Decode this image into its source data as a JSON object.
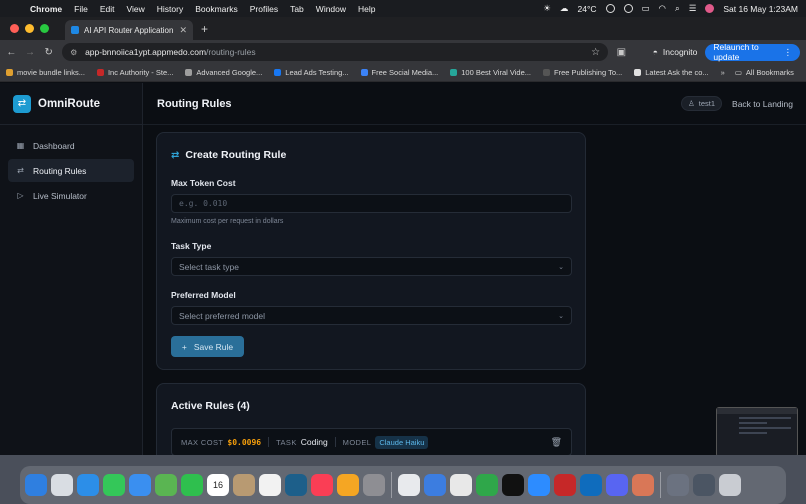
{
  "menubar": {
    "app": "Chrome",
    "items": [
      "File",
      "Edit",
      "View",
      "History",
      "Bookmarks",
      "Profiles",
      "Tab",
      "Window",
      "Help"
    ],
    "temperature": "24°C",
    "datetime": "Sat 16 May  1:23AM"
  },
  "browser": {
    "tab_title": "AI API Router Application",
    "url_host": "app-bnnoiica1ypt.appmedo.com",
    "url_path": "/routing-rules",
    "incognito_label": "Incognito",
    "relaunch_label": "Relaunch to update",
    "bookmarks": [
      {
        "label": "movie bundle links...",
        "color": "#e0a030"
      },
      {
        "label": "Inc Authority - Ste...",
        "color": "#c62828"
      },
      {
        "label": "Advanced Google...",
        "color": "#9e9e9e"
      },
      {
        "label": "Lead Ads Testing...",
        "color": "#1877f2"
      },
      {
        "label": "Free Social Media...",
        "color": "#3b82f6"
      },
      {
        "label": "100 Best Viral Vide...",
        "color": "#26a69a"
      },
      {
        "label": "Free Publishing To...",
        "color": "#555555"
      },
      {
        "label": "Latest Ask the co...",
        "color": "#e0e0e0"
      }
    ],
    "all_bookmarks_label": "All Bookmarks"
  },
  "app": {
    "brand": "OmniRoute",
    "nav": [
      {
        "label": "Dashboard",
        "icon": "dashboard-icon",
        "active": false
      },
      {
        "label": "Routing Rules",
        "icon": "routing-icon",
        "active": true
      },
      {
        "label": "Live Simulator",
        "icon": "play-icon",
        "active": false
      }
    ],
    "page_title": "Routing Rules",
    "user": "test1",
    "back_link": "Back to Landing",
    "create_form": {
      "title": "Create Routing Rule",
      "max_token_cost_label": "Max Token Cost",
      "max_token_cost_placeholder": "e.g. 0.010",
      "max_token_cost_hint": "Maximum cost per request in dollars",
      "task_type_label": "Task Type",
      "task_type_placeholder": "Select task type",
      "preferred_model_label": "Preferred Model",
      "preferred_model_placeholder": "Select preferred model",
      "save_label": "Save Rule"
    },
    "active_rules": {
      "title": "Active Rules (4)",
      "rules": [
        {
          "max_cost_label": "MAX COST",
          "max_cost": "$0.0096",
          "task_label": "TASK",
          "task": "Coding",
          "model_label": "MODEL",
          "model": "Claude Haiku"
        }
      ]
    }
  },
  "dock": {
    "icons": [
      {
        "name": "finder-icon",
        "color": "#2f7fe0"
      },
      {
        "name": "launchpad-icon",
        "color": "#d9dde3"
      },
      {
        "name": "safari-icon",
        "color": "#2c8ee8"
      },
      {
        "name": "messages-icon",
        "color": "#34c759"
      },
      {
        "name": "mail-icon",
        "color": "#3a8ff0"
      },
      {
        "name": "maps-icon",
        "color": "#5ab552"
      },
      {
        "name": "facetime-icon",
        "color": "#2fbf4e"
      },
      {
        "name": "calendar-icon",
        "color": "#ffffff",
        "text": "16"
      },
      {
        "name": "contacts-icon",
        "color": "#b89a72"
      },
      {
        "name": "reminders-icon",
        "color": "#f2f2f2"
      },
      {
        "name": "freeform-icon",
        "color": "#1d5f8a"
      },
      {
        "name": "music-icon",
        "color": "#fa3e55"
      },
      {
        "name": "pages-icon",
        "color": "#f5a623"
      },
      {
        "name": "settings-icon",
        "color": "#8e8e93"
      },
      {
        "name": "chrome-icon",
        "color": "#e8eaed"
      },
      {
        "name": "preview-icon",
        "color": "#3c7de0"
      },
      {
        "name": "notes-icon",
        "color": "#e8e8e8"
      },
      {
        "name": "numbers-icon",
        "color": "#2fa74a"
      },
      {
        "name": "tv-icon",
        "color": "#111111"
      },
      {
        "name": "zoom-icon",
        "color": "#2d8cff"
      },
      {
        "name": "word-icon",
        "color": "#c62828"
      },
      {
        "name": "outlook-icon",
        "color": "#0f6cbd"
      },
      {
        "name": "discord-icon",
        "color": "#5865f2"
      },
      {
        "name": "claude-icon",
        "color": "#d97757"
      },
      {
        "name": "files-icon",
        "color": "#6b7280"
      },
      {
        "name": "desktop-icon",
        "color": "#4b5563"
      },
      {
        "name": "trash-icon",
        "color": "#c9ccd2"
      }
    ]
  }
}
